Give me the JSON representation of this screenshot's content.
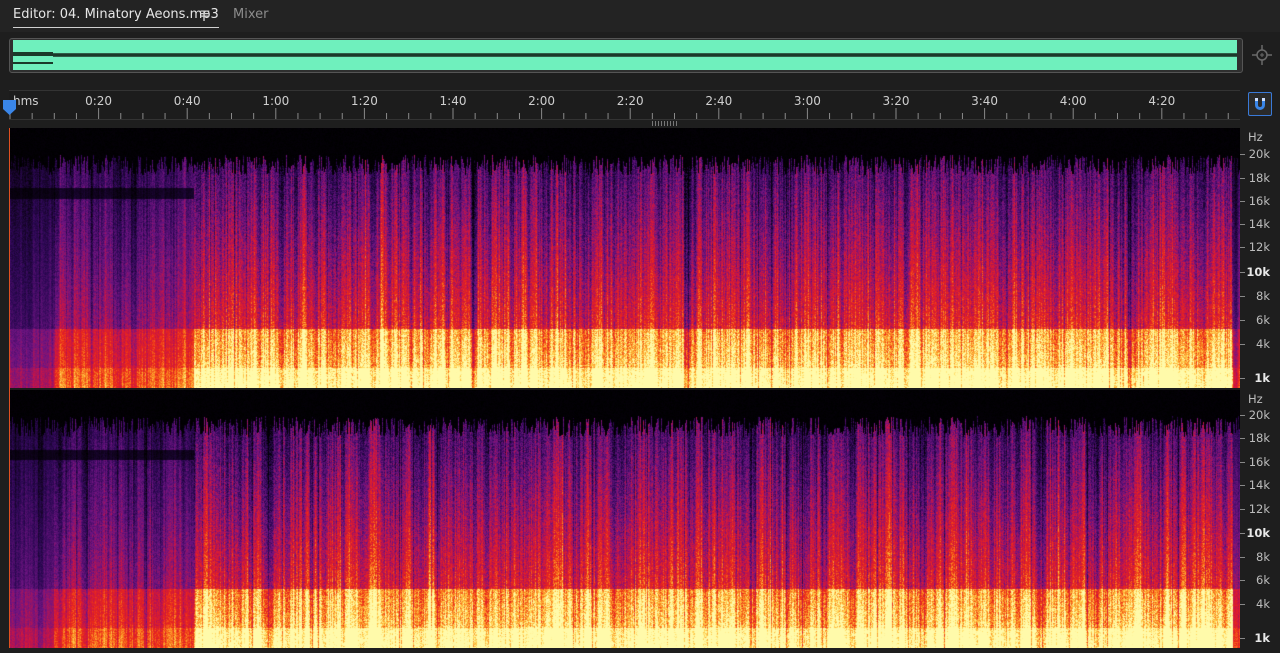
{
  "tabs": {
    "editor_label": "Editor: 04. Minatory Aeons.mp3",
    "editor_menu_icon": "≡",
    "mixer_label": "Mixer"
  },
  "ruler": {
    "unit": "hms",
    "labels": [
      "0:20",
      "0:40",
      "1:00",
      "1:20",
      "1:40",
      "2:00",
      "2:20",
      "2:40",
      "3:00",
      "3:20",
      "3:40",
      "4:00",
      "4:20"
    ]
  },
  "hz_scale": {
    "unit": "Hz",
    "labels": [
      "20k",
      "18k",
      "16k",
      "14k",
      "12k",
      "10k",
      "8k",
      "6k",
      "4k",
      "1k"
    ]
  },
  "icons": {
    "editor_menu": "hamburger-icon",
    "zoom": "zoom-to-selection-icon",
    "snap": "magnet-snap-icon",
    "playhead": "playhead-marker-icon"
  },
  "colors": {
    "waveform": "#6ff0bd",
    "accent": "#3a7ad8",
    "background": "#1e1e1e"
  }
}
